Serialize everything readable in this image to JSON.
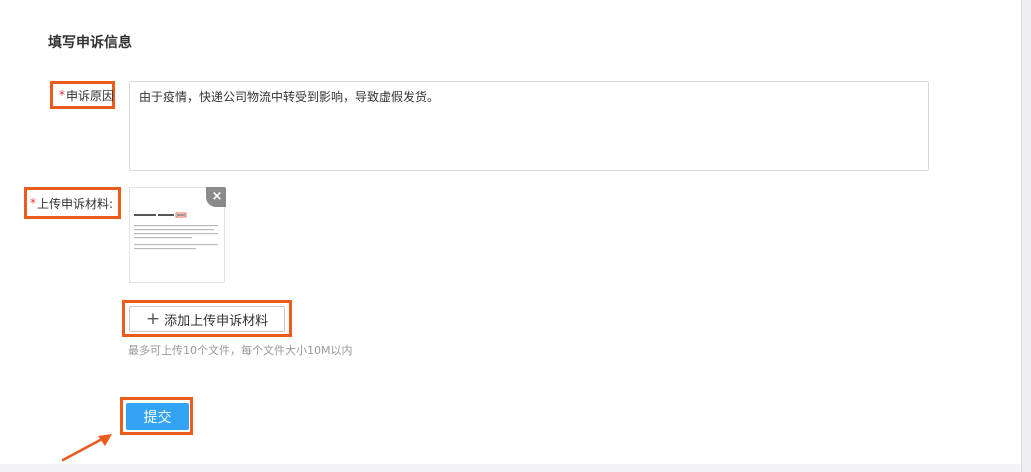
{
  "section": {
    "title": "填写申诉信息"
  },
  "reason": {
    "required_mark": "*",
    "label": "申诉原因",
    "value": "由于疫情，快递公司物流中转受到影响，导致虚假发货。"
  },
  "upload": {
    "required_mark": "*",
    "label": "上传申诉材料:",
    "remove_icon": "×",
    "add_icon": "+",
    "add_label": "添加上传申诉材料",
    "hint": "最多可上传10个文件，每个文件大小10M以内"
  },
  "submit": {
    "label": "提交"
  },
  "colors": {
    "highlight_border": "#ec5a1c",
    "submit_bg": "#33a3f4",
    "required": "#e4393c"
  }
}
